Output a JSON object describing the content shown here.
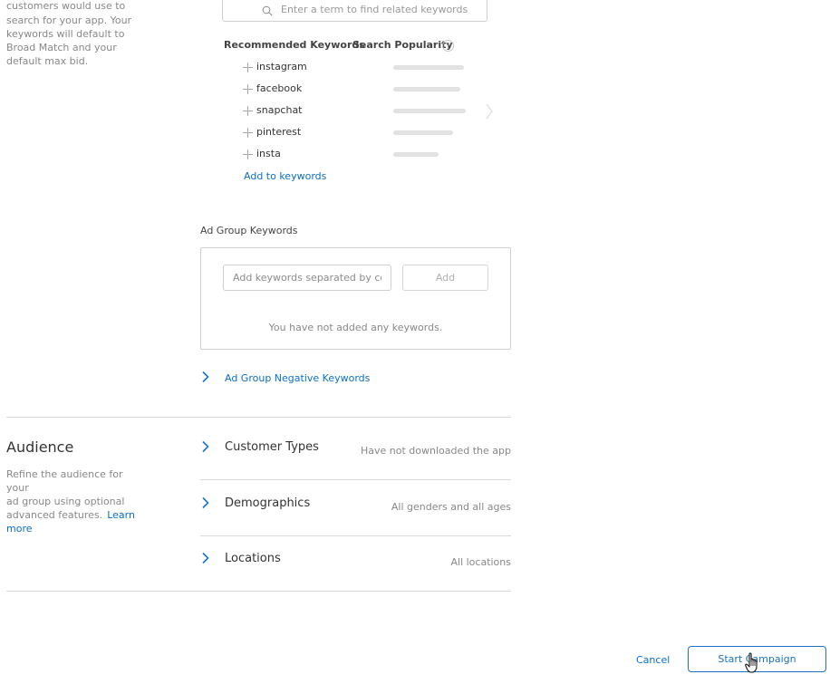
{
  "intro": {
    "text_lines": [
      "customers would use to",
      "search for your app. Your",
      "keywords will default to",
      "Broad Match and your",
      "default max bid."
    ]
  },
  "keyword_search": {
    "placeholder": "Enter a term to find related keywords"
  },
  "recommended": {
    "col_keywords": "Recommended Keywords",
    "col_popularity": "Search Popularity",
    "items": [
      {
        "label": "instagram",
        "popularity": 0.98
      },
      {
        "label": "facebook",
        "popularity": 0.92
      },
      {
        "label": "snapchat",
        "popularity": 1.0
      },
      {
        "label": "pinterest",
        "popularity": 0.82
      },
      {
        "label": "insta",
        "popularity": 0.62
      }
    ],
    "add_link": "Add to keywords"
  },
  "ad_group_keywords": {
    "title": "Ad Group Keywords",
    "input_placeholder": "Add keywords separated by commas",
    "add_button": "Add",
    "empty_message": "You have not added any keywords."
  },
  "negative_keywords": {
    "label": "Ad Group Negative Keywords"
  },
  "audience": {
    "title": "Audience",
    "desc_lines": [
      "Refine the audience for your",
      "ad group using optional",
      "advanced features."
    ],
    "learn": "Learn",
    "more": "more",
    "sections": [
      {
        "label": "Customer Types",
        "value": "Have not downloaded the app"
      },
      {
        "label": "Demographics",
        "value": "All genders and all ages"
      },
      {
        "label": "Locations",
        "value": "All locations"
      }
    ]
  },
  "footer": {
    "cancel": "Cancel",
    "start": "Start Campaign"
  },
  "colors": {
    "accent": "#1a73c6",
    "link": "#0a70c9",
    "divider": "#d9d9d9"
  }
}
